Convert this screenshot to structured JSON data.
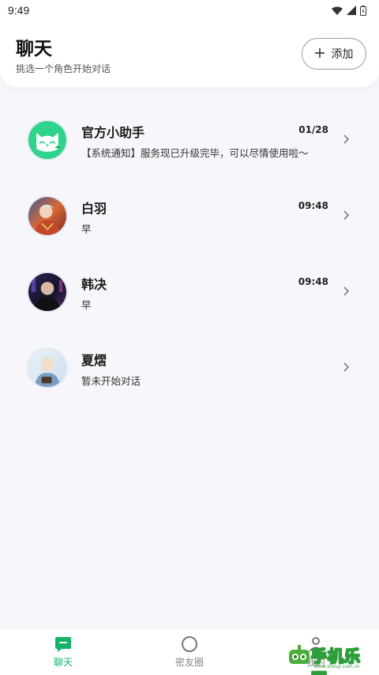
{
  "status_bar": {
    "time": "9:49",
    "icons": [
      "wifi-icon",
      "signal-icon",
      "battery-icon"
    ]
  },
  "header": {
    "title": "聊天",
    "subtitle": "挑选一个角色开始对话",
    "add_button_label": "添加",
    "add_button_icon": "plus-icon"
  },
  "chats": [
    {
      "name": "官方小助手",
      "time": "01/28",
      "preview": "【系统通知】服务现已升级完毕，可以尽情使用啦～",
      "avatar": "cat-logo-avatar"
    },
    {
      "name": "白羽",
      "time": "09:48",
      "preview": "早",
      "avatar": "character-avatar"
    },
    {
      "name": "韩决",
      "time": "09:48",
      "preview": "早",
      "avatar": "character-avatar"
    },
    {
      "name": "夏熠",
      "time": "",
      "preview": "暂未开始对话",
      "avatar": "character-avatar"
    }
  ],
  "bottom_nav": {
    "items": [
      {
        "label": "聊天",
        "icon": "chat-bubble-icon",
        "active": true
      },
      {
        "label": "密友圈",
        "icon": "circle-icon",
        "active": false
      },
      {
        "label": "我的",
        "icon": "profile-icon",
        "active": false
      }
    ]
  },
  "watermark": {
    "text": "手机乐园",
    "url": "www.shouji.com.cn"
  },
  "colors": {
    "accent": "#17b26a",
    "background": "#f7f7fb",
    "card": "#ffffff",
    "text_primary": "#1a1a1a",
    "text_secondary": "#555555"
  }
}
